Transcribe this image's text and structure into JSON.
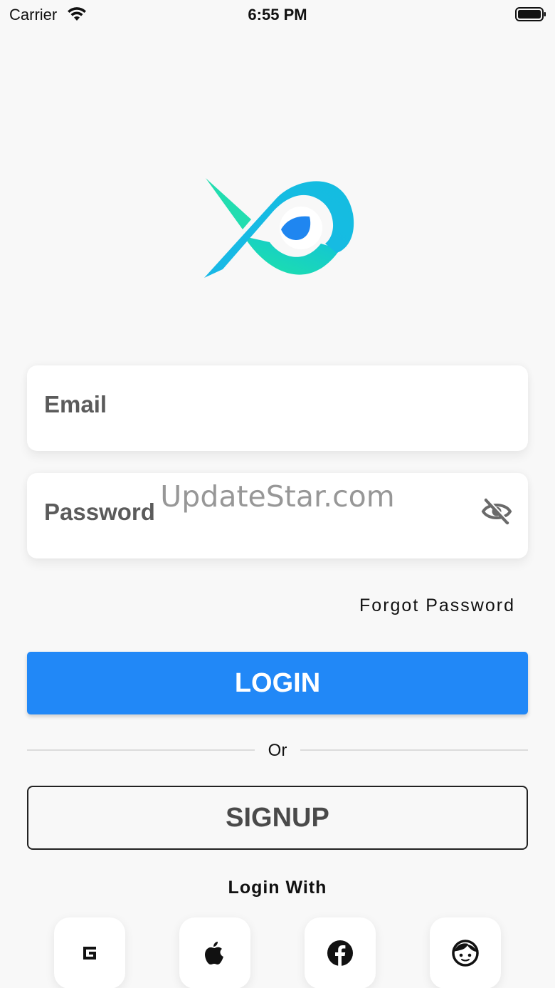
{
  "status_bar": {
    "carrier": "Carrier",
    "time": "6:55 PM",
    "icons": [
      "wifi-icon",
      "battery-icon"
    ]
  },
  "logo": {
    "icon": "fish-logo",
    "colors": [
      "#2cd9b5",
      "#1bb8e6",
      "#1e8cf0"
    ]
  },
  "form": {
    "email_label": "Email",
    "password_label": "Password",
    "password_toggle_icon": "eye-slash-icon",
    "forgot_password": "Forgot Password"
  },
  "watermark": "UpdateStar.com",
  "actions": {
    "login_label": "LOGIN",
    "divider_text": "Or",
    "signup_label": "SIGNUP"
  },
  "social": {
    "title": "Login With",
    "providers": [
      "google-icon",
      "apple-icon",
      "facebook-icon",
      "guest-face-icon"
    ]
  },
  "colors": {
    "primary": "#2188f7",
    "background": "#f8f8f8",
    "field_label": "#5b5b5b"
  }
}
